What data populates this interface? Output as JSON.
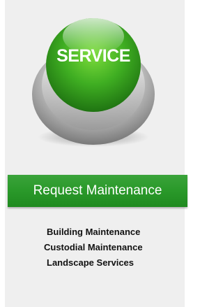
{
  "service_button": {
    "label": "SERVICE",
    "icon": "service-button-icon"
  },
  "request_button": {
    "label": "Request Maintenance"
  },
  "services": [
    {
      "label": "Building Maintenance"
    },
    {
      "label": "Custodial Maintenance"
    },
    {
      "label": "Landscape Services"
    }
  ],
  "colors": {
    "primary_green": "#2b9a2b",
    "panel_background": "#efefef",
    "text": "#111111"
  }
}
